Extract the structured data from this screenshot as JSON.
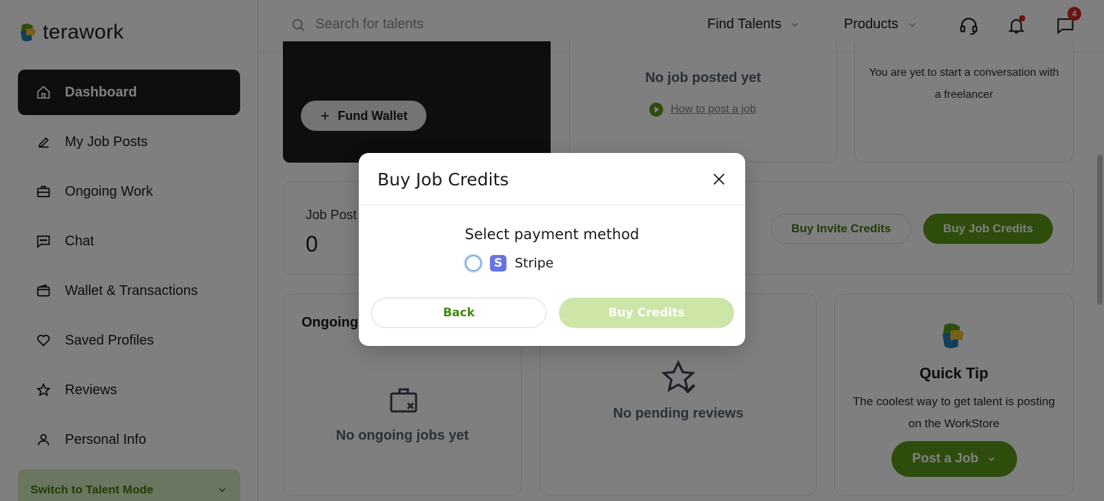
{
  "brand": {
    "name": "terawork"
  },
  "sidebar": {
    "items": [
      {
        "label": "Dashboard",
        "icon": "home-icon",
        "active": true
      },
      {
        "label": "My Job Posts",
        "icon": "edit-icon",
        "active": false
      },
      {
        "label": "Ongoing Work",
        "icon": "briefcase-icon",
        "active": false
      },
      {
        "label": "Chat",
        "icon": "chat-icon",
        "active": false
      },
      {
        "label": "Wallet & Transactions",
        "icon": "wallet-icon",
        "active": false
      },
      {
        "label": "Saved Profiles",
        "icon": "heart-icon",
        "active": false
      },
      {
        "label": "Reviews",
        "icon": "star-icon",
        "active": false
      },
      {
        "label": "Personal Info",
        "icon": "user-icon",
        "active": false
      }
    ],
    "switch_mode": "Switch to Talent Mode"
  },
  "header": {
    "search_placeholder": "Search for talents",
    "menu": [
      {
        "label": "Find Talents"
      },
      {
        "label": "Products"
      }
    ],
    "messages_count": "4"
  },
  "wallet": {
    "fund_label": "Fund Wallet"
  },
  "jobs": {
    "empty_text": "No job posted yet",
    "link_text": "How to post a job"
  },
  "conversations": {
    "empty_text": "You are yet to start a conversation with a freelancer"
  },
  "credits": {
    "label": "Job Post",
    "value": "0",
    "invite_btn": "Buy Invite Credits",
    "job_btn": "Buy Job Credits"
  },
  "ongoing": {
    "title": "Ongoing",
    "empty_text": "No ongoing jobs yet"
  },
  "reviews": {
    "empty_text": "No pending reviews"
  },
  "tip": {
    "title": "Quick Tip",
    "text": "The coolest way to get talent is posting on the WorkStore",
    "button": "Post a Job"
  },
  "modal": {
    "title": "Buy Job Credits",
    "subtitle": "Select payment method",
    "option": "Stripe",
    "option_logo": "S",
    "back": "Back",
    "buy": "Buy Credits"
  },
  "colors": {
    "brand_green": "#5c9b1a",
    "dark": "#1d1d1d",
    "muted_green": "#cde6a8"
  }
}
